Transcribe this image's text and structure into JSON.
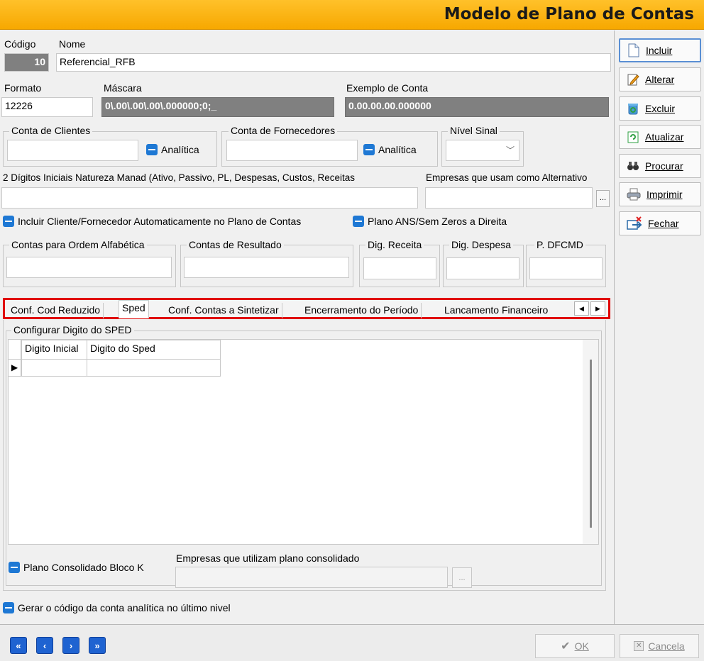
{
  "title": "Modelo de Plano de Contas",
  "fields": {
    "codigo_label": "Código",
    "codigo_value": "10",
    "nome_label": "Nome",
    "nome_value": "Referencial_RFB",
    "formato_label": "Formato",
    "formato_value": "12226",
    "mascara_label": "Máscara",
    "mascara_value": "0\\.00\\.00\\.00\\.000000;0;_",
    "exemplo_label": "Exemplo de Conta",
    "exemplo_value": "0.00.00.00.000000"
  },
  "groups": {
    "conta_clientes": "Conta de Clientes",
    "conta_fornecedores": "Conta de Fornecedores",
    "nivel_sinal": "Nível Sinal",
    "analitica": "Analítica",
    "digitos_label": "2 Dígitos Iniciais Natureza Manad (Ativo, Passivo, PL, Despesas, Custos, Receitas",
    "empresas_alt_label": "Empresas que usam como Alternativo",
    "ellipsis": "...",
    "incluir_cliente": "Incluir Cliente/Fornecedor Automaticamente no Plano de Contas",
    "plano_ans": "Plano ANS/Sem Zeros a Direita",
    "contas_ordem": "Contas para Ordem  Alfabética",
    "contas_resultado": "Contas de Resultado",
    "dig_receita": "Dig. Receita",
    "dig_despesa": "Dig. Despesa",
    "p_dfcmd": "P. DFCMD"
  },
  "tabs": [
    {
      "label": "Conf. Cod Reduzido"
    },
    {
      "label": "Sped"
    },
    {
      "label": "Conf. Contas a Sintetizar"
    },
    {
      "label": "Encerramento do Período"
    },
    {
      "label": "Lancamento Financeiro"
    }
  ],
  "sped": {
    "group_title": "Configurar Digito do SPED",
    "columns": [
      "Digito Inicial",
      "Digito do Sped"
    ],
    "plano_consolidado": "Plano Consolidado Bloco K",
    "empresas_consolidado": "Empresas que utilizam plano consolidado",
    "ellipsis": "..."
  },
  "gerar_codigo": "Gerar o código da conta analítica no último nivel",
  "side_buttons": [
    {
      "label": "Incluir",
      "icon": "document-icon"
    },
    {
      "label": "Alterar",
      "icon": "edit-icon"
    },
    {
      "label": "Excluir",
      "icon": "recycle-icon"
    },
    {
      "label": "Atualizar",
      "icon": "refresh-icon"
    },
    {
      "label": "Procurar",
      "icon": "binoculars-icon"
    },
    {
      "label": "Imprimir",
      "icon": "printer-icon"
    },
    {
      "label": "Fechar",
      "icon": "exit-icon"
    }
  ],
  "bottom": {
    "ok": "OK",
    "cancela": "Cancela"
  },
  "colors": {
    "title_bar": "#f7a800",
    "checkbox": "#1e78d4",
    "tab_highlight": "#e00000",
    "nav_button": "#1f63d1"
  }
}
